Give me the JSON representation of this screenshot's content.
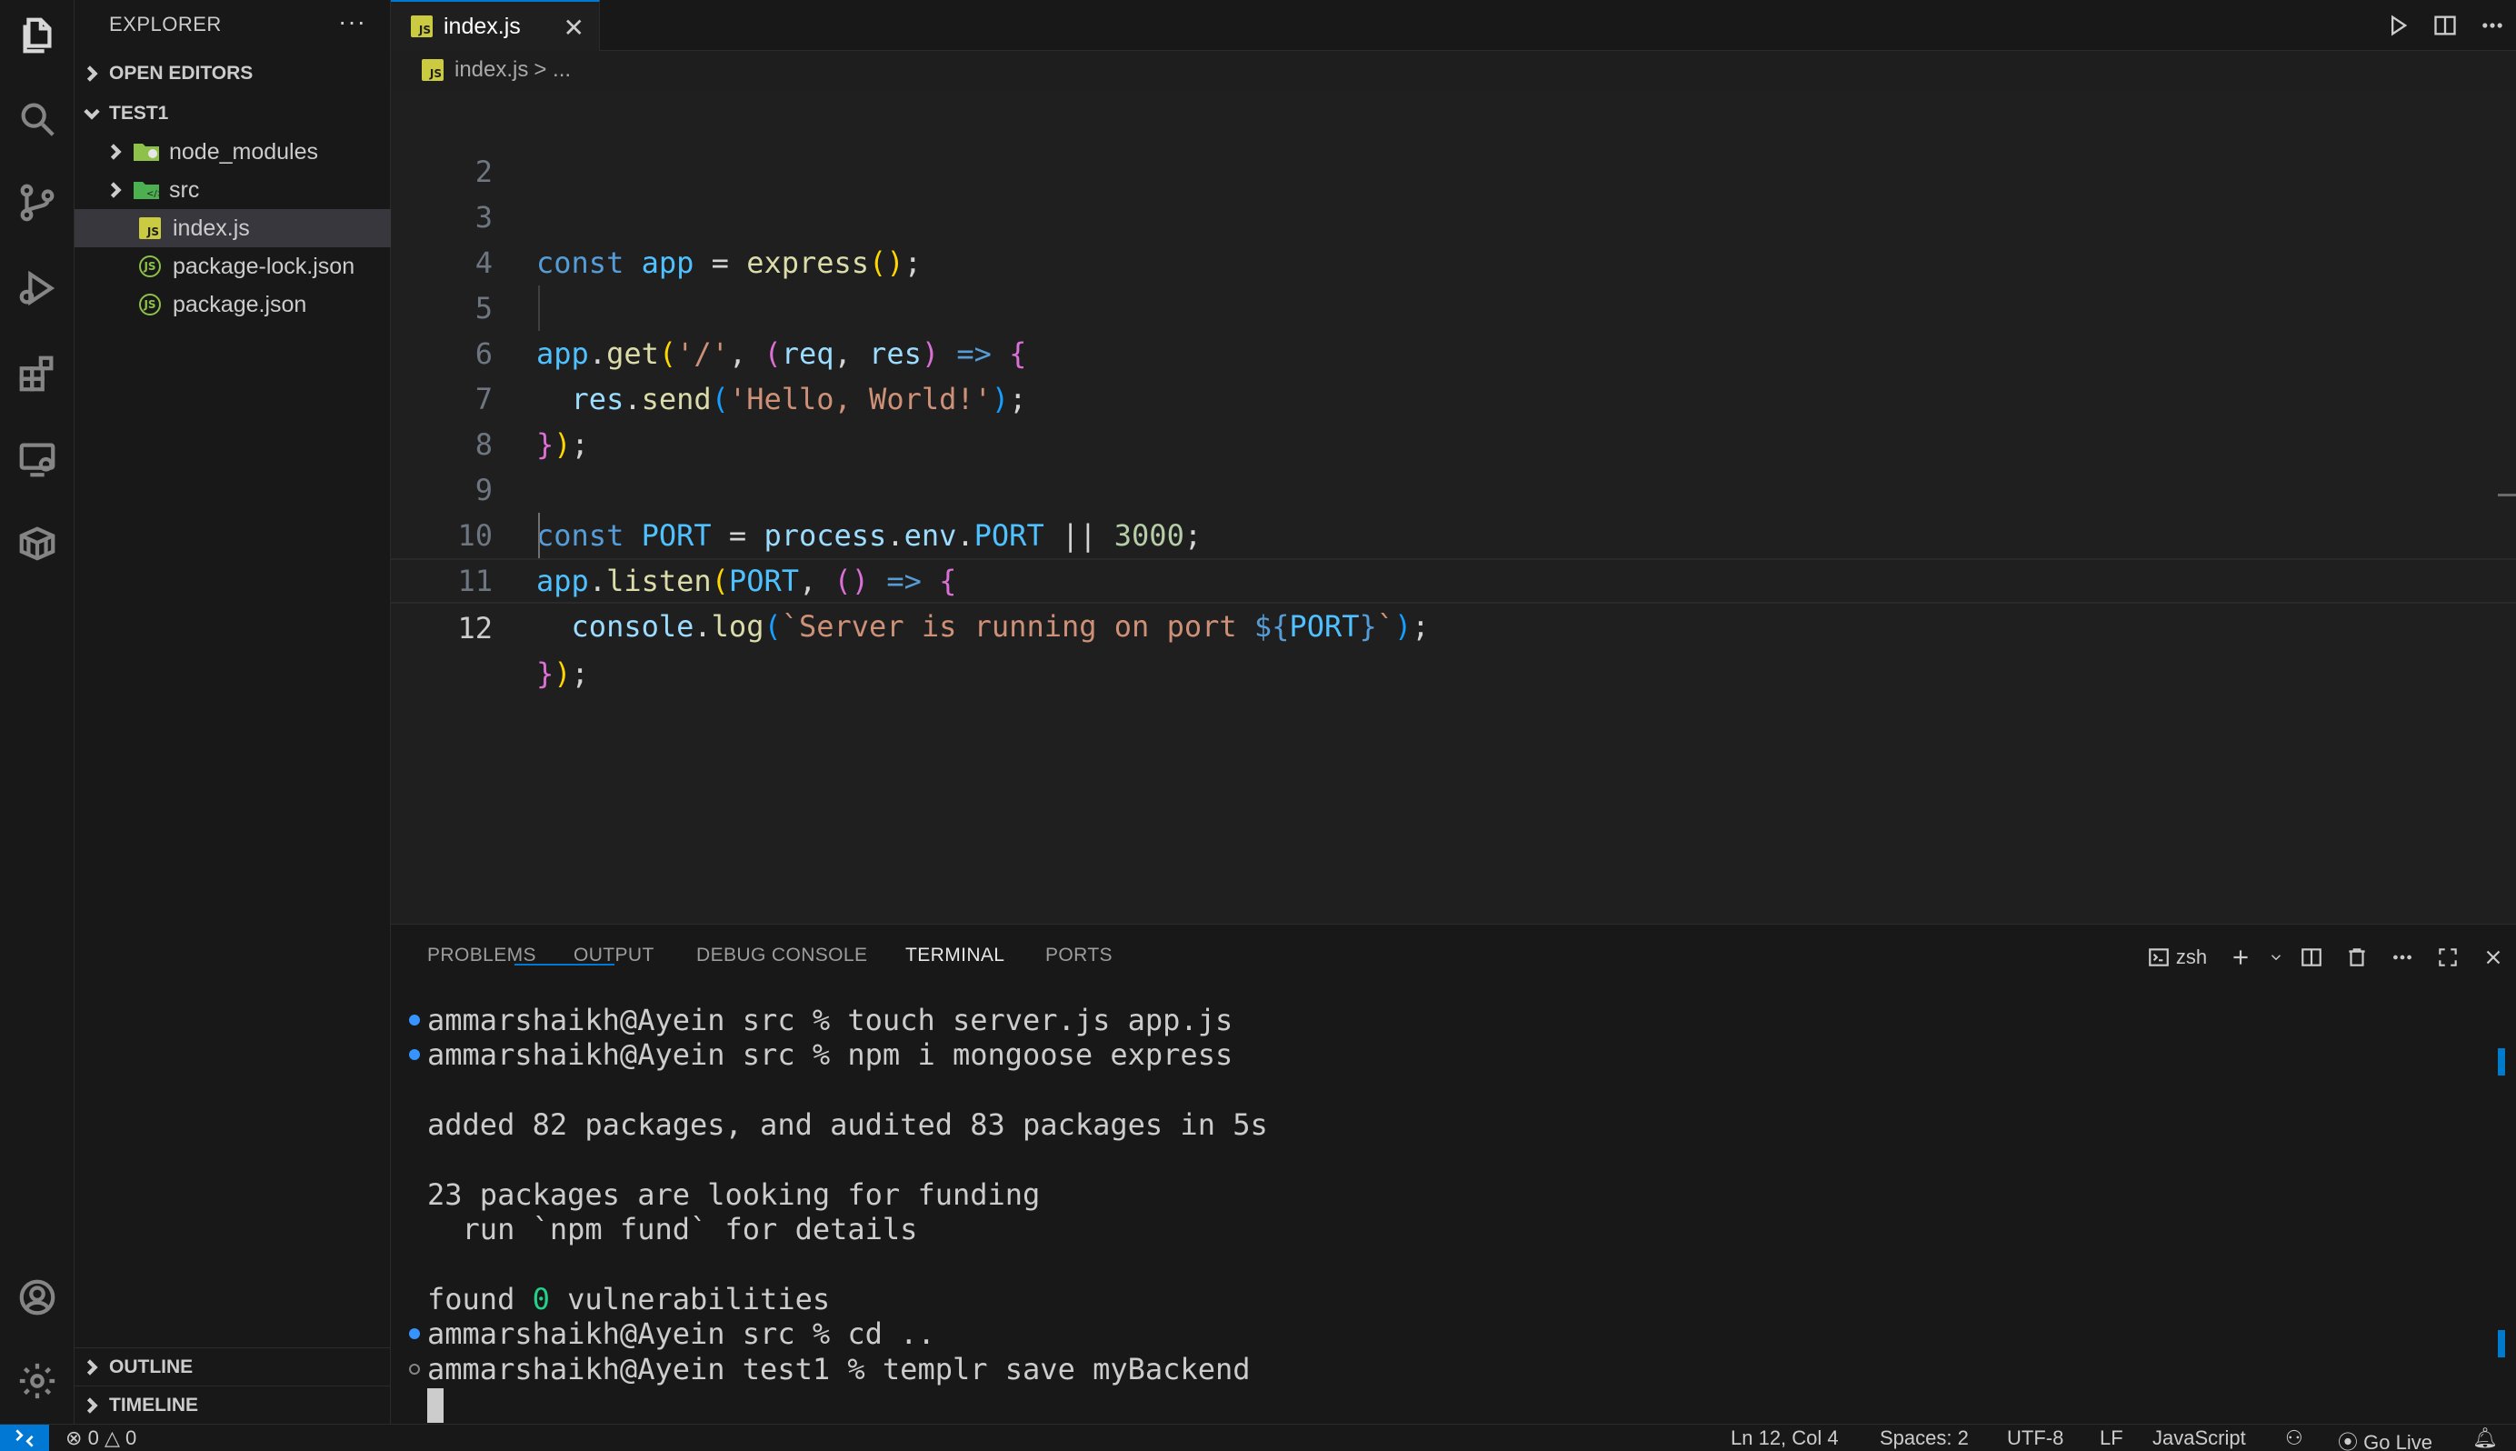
{
  "sidebar": {
    "title": "EXPLORER",
    "more": "···",
    "open_editors": "OPEN EDITORS",
    "workspace": "TEST1",
    "files": [
      "node_modules",
      "src",
      "index.js",
      "package-lock.json",
      "package.json"
    ],
    "outline": "OUTLINE",
    "timeline": "TIMELINE"
  },
  "tab": {
    "label": "index.js",
    "close": "✕"
  },
  "breadcrumb": {
    "file": "index.js",
    "rest": "> ..."
  },
  "editor": {
    "line_numbers": [
      "2",
      "3",
      "4",
      "5",
      "6",
      "7",
      "8",
      "9",
      "10",
      "11",
      "12"
    ]
  },
  "panel": {
    "tabs": [
      "PROBLEMS",
      "OUTPUT",
      "DEBUG CONSOLE",
      "TERMINAL",
      "PORTS"
    ],
    "active_tab": "TERMINAL",
    "shell": "zsh",
    "terminal": {
      "l1": "ammarshaikh@Ayein src % touch server.js app.js",
      "l2": "ammarshaikh@Ayein src % npm i mongoose express",
      "l3": "added 82 packages, and audited 83 packages in 5s",
      "l4": "23 packages are looking for funding",
      "l5": "  run `npm fund` for details",
      "l6a": "found ",
      "l6b": "0",
      "l6c": " vulnerabilities",
      "l7": "ammarshaikh@Ayein src % cd ..",
      "l8": "ammarshaikh@Ayein test1 % templr save myBackend"
    }
  },
  "status": {
    "errors": "0",
    "warnings": "0",
    "position": "Ln 12, Col 4",
    "spaces": "Spaces: 2",
    "encoding": "UTF-8",
    "eol": "LF",
    "language": "JavaScript",
    "go_live": "Go Live"
  },
  "colors": {
    "accent": "#0078d4",
    "keyword": "#569cd6",
    "string": "#ce9178",
    "function": "#dcdcaa"
  }
}
